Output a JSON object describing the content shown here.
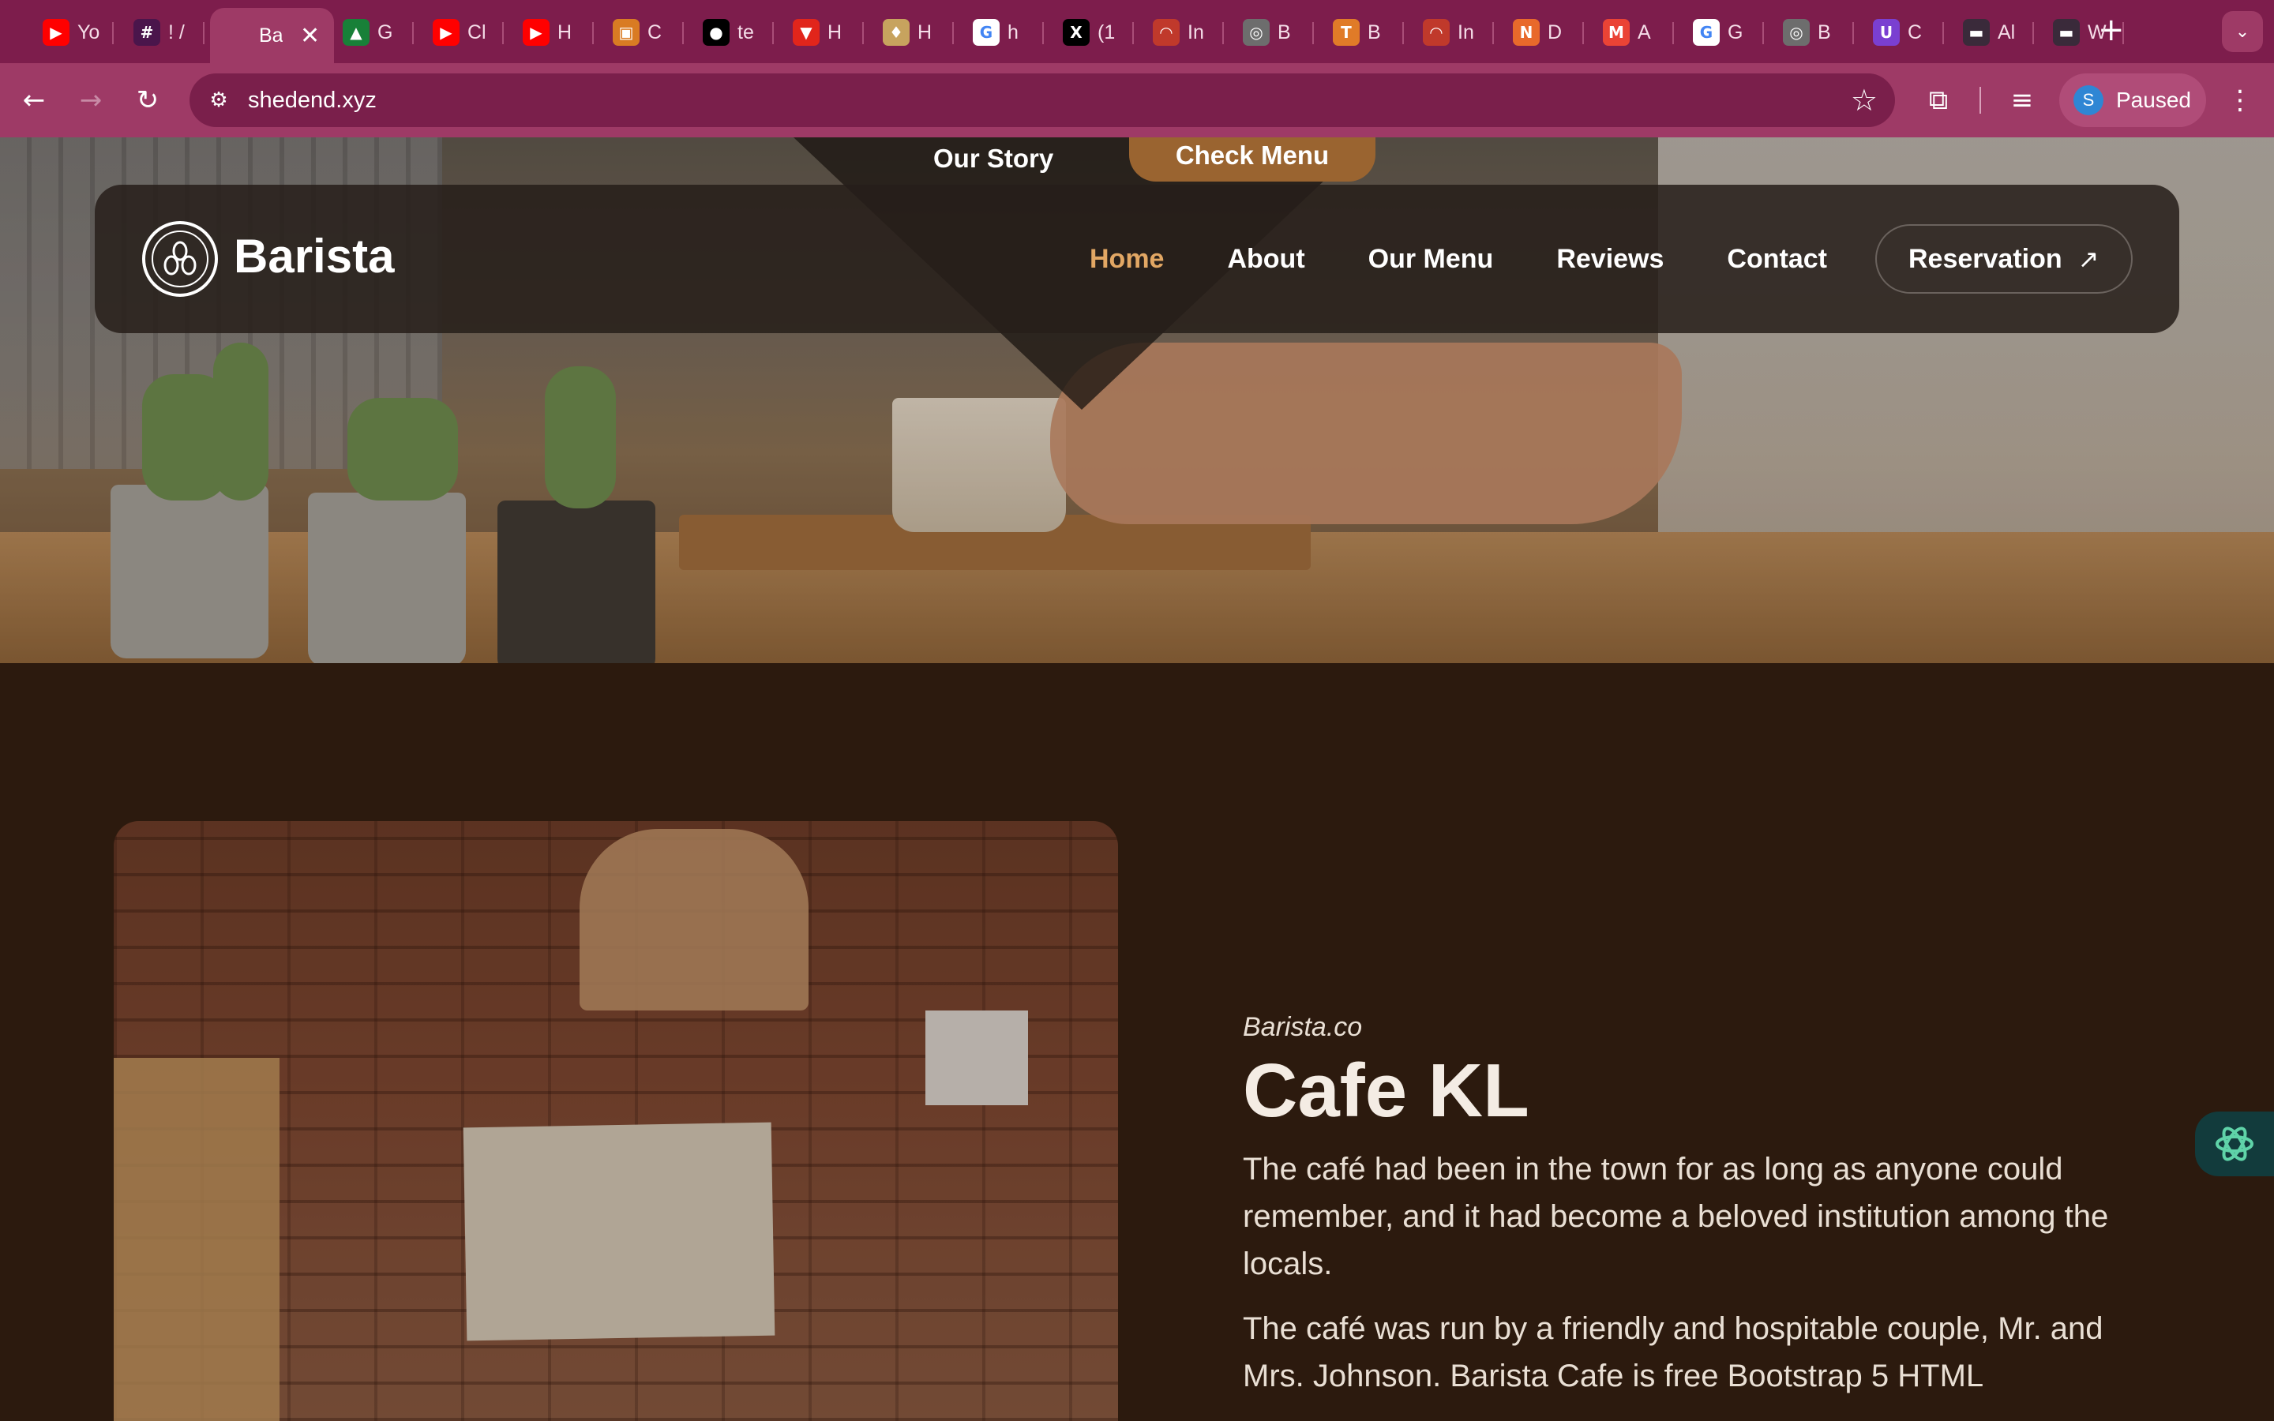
{
  "browser": {
    "tabs": [
      {
        "title": "Yo",
        "icon": "youtube-icon",
        "color": "#ff0000",
        "glyph": "▶"
      },
      {
        "title": "! /",
        "icon": "slack-icon",
        "color": "#4a154b",
        "glyph": "#"
      },
      {
        "title": "Ba",
        "icon": "site-icon",
        "color": "#9e3a66",
        "glyph": "",
        "active": true
      },
      {
        "title": "G",
        "icon": "google-drive-icon",
        "color": "#188038",
        "glyph": "▲"
      },
      {
        "title": "Cl",
        "icon": "youtube-icon",
        "color": "#ff0000",
        "glyph": "▶"
      },
      {
        "title": "H",
        "icon": "youtube-icon",
        "color": "#ff0000",
        "glyph": "▶"
      },
      {
        "title": "C",
        "icon": "windows-icon",
        "color": "#d97b23",
        "glyph": "▣"
      },
      {
        "title": "te",
        "icon": "github-icon",
        "color": "#000000",
        "glyph": "●"
      },
      {
        "title": "H",
        "icon": "vercel-icon",
        "color": "#e1251b",
        "glyph": "▼"
      },
      {
        "title": "H",
        "icon": "jar-icon",
        "color": "#c7a35e",
        "glyph": "♦"
      },
      {
        "title": "h",
        "icon": "google-icon",
        "color": "#ffffff",
        "glyph": "G"
      },
      {
        "title": "(1",
        "icon": "x-icon",
        "color": "#000000",
        "glyph": "X"
      },
      {
        "title": "In",
        "icon": "gauge-icon",
        "color": "#c0392b",
        "glyph": "◠"
      },
      {
        "title": "B",
        "icon": "globe-icon",
        "color": "#6d6d6d",
        "glyph": "◎"
      },
      {
        "title": "B",
        "icon": "text-icon",
        "color": "#e07b28",
        "glyph": "T"
      },
      {
        "title": "In",
        "icon": "gauge-icon",
        "color": "#c0392b",
        "glyph": "◠"
      },
      {
        "title": "D",
        "icon": "analytics-icon",
        "color": "#e8692b",
        "glyph": "N"
      },
      {
        "title": "A",
        "icon": "gmail-icon",
        "color": "#ea4335",
        "glyph": "M"
      },
      {
        "title": "G",
        "icon": "google-icon",
        "color": "#ffffff",
        "glyph": "G"
      },
      {
        "title": "B",
        "icon": "globe-icon",
        "color": "#6d6d6d",
        "glyph": "◎"
      },
      {
        "title": "C",
        "icon": "shield-u-icon",
        "color": "#7a3fd1",
        "glyph": "U"
      },
      {
        "title": "Al",
        "icon": "folder-icon",
        "color": "#3a2a3a",
        "glyph": "▬"
      },
      {
        "title": "W",
        "icon": "folder-icon",
        "color": "#3a2a3a",
        "glyph": "▬"
      }
    ],
    "active_tab_close": "✕",
    "new_tab": "+",
    "tab_search": "⌄",
    "back": "←",
    "forward": "→",
    "reload": "↻",
    "site_info": "⚙",
    "url": "shedend.xyz",
    "bookmark": "☆",
    "extensions": "⧉",
    "media": "≡",
    "profile": {
      "initial": "S",
      "label": "Paused"
    },
    "menu": "⋮"
  },
  "hero": {
    "story_link": "Our Story",
    "menu_button": "Check Menu"
  },
  "nav": {
    "brand": "Barista",
    "links": [
      "Home",
      "About",
      "Our Menu",
      "Reviews",
      "Contact"
    ],
    "active": "Home",
    "reservation": "Reservation",
    "reservation_arrow": "↗"
  },
  "about": {
    "tagline": "Barista.co",
    "heading": "Cafe KL",
    "paragraphs": [
      "The café had been in the town for as long as anyone could remember, and it had become a beloved institution among the locals.",
      "The café was run by a friendly and hospitable couple, Mr. and Mrs. Johnson. Barista Cafe is free Bootstrap 5 HTML"
    ]
  },
  "colors": {
    "accent": "#e2a764",
    "button": "#9a6430",
    "background": "#2c1a0e",
    "chrome": "#7d1d4c"
  }
}
